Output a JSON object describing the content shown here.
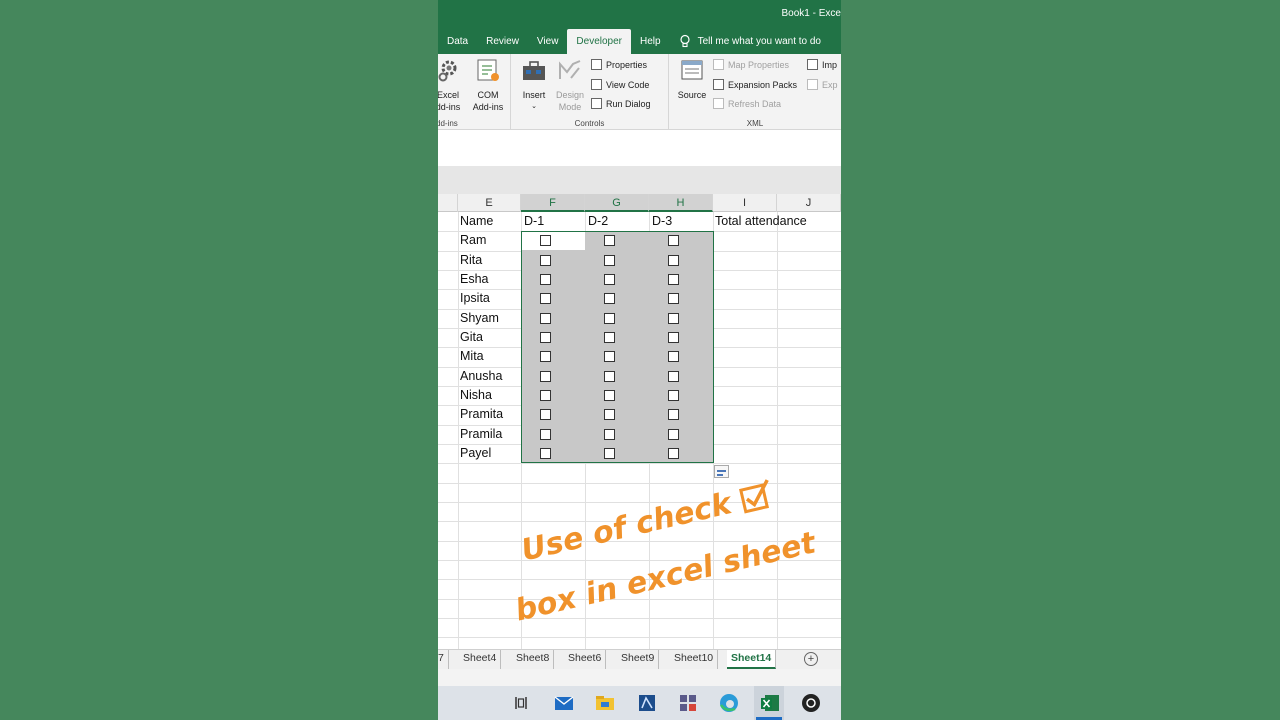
{
  "window": {
    "title": "Book1 - Exce"
  },
  "tabs": [
    "Data",
    "Review",
    "View",
    "Developer",
    "Help"
  ],
  "active_tab": "Developer",
  "tell_me": "Tell me what you want to do",
  "ribbon": {
    "addins": {
      "excel": [
        "Excel",
        "dd-ins"
      ],
      "com": [
        "COM",
        "Add-ins"
      ],
      "label": "dd-ins"
    },
    "controls": {
      "insert": "Insert",
      "design": [
        "Design",
        "Mode"
      ],
      "properties": "Properties",
      "view_code": "View Code",
      "run_dialog": "Run Dialog",
      "label": "Controls"
    },
    "xml": {
      "source": "Source",
      "map_properties": "Map Properties",
      "expansion_packs": "Expansion Packs",
      "refresh_data": "Refresh Data",
      "import": "Imp",
      "export": "Exp",
      "label": "XML"
    }
  },
  "columns": [
    "E",
    "F",
    "G",
    "H",
    "I",
    "J"
  ],
  "headers": {
    "name": "Name",
    "d1": "D-1",
    "d2": "D-2",
    "d3": "D-3",
    "total": "Total attendance"
  },
  "names": [
    "Ram",
    "Rita",
    "Esha",
    "Ipsita",
    "Shyam",
    "Gita",
    "Mita",
    "Anusha",
    "Nisha",
    "Pramita",
    "Pramila",
    "Payel"
  ],
  "caption": {
    "line1": "Use of check",
    "line2": "box in excel sheet"
  },
  "sheets": [
    "7",
    "Sheet4",
    "Sheet8",
    "Sheet6",
    "Sheet9",
    "Sheet10",
    "Sheet14"
  ],
  "active_sheet": "Sheet14",
  "colors": {
    "excel_green": "#217346",
    "caption_orange": "#f0922b",
    "background": "#45875c"
  }
}
